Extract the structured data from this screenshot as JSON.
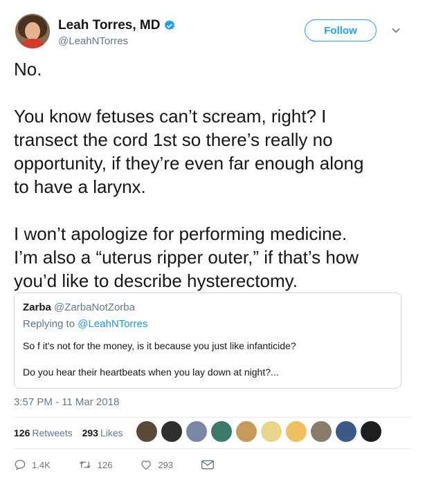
{
  "user": {
    "display_name": "Leah Torres, MD",
    "handle": "@LeahNTorres",
    "follow_label": "Follow"
  },
  "tweet": {
    "p1": "No.",
    "p2_l1": "You know fetuses can’t scream, right? I",
    "p2_l2": "transect the cord 1st so there’s really no",
    "p2_l3": "opportunity, if they’re even far enough along",
    "p2_l4": "to have a larynx.",
    "p3_l1": "I won’t apologize for performing medicine.",
    "p3_l2": "I’m also a “uterus ripper outer,” if that’s how",
    "p3_l3": "you’d like to describe hysterectomy."
  },
  "quote": {
    "name": "Zarba",
    "handle": "@ZarbaNotZorba",
    "replying_prefix": "Replying to ",
    "replying_handle": "@LeahNTorres",
    "line1": "So f it's not for the money, is it because you just like infanticide?",
    "line2": "Do you hear their heartbeats when you lay down at night?..."
  },
  "meta": {
    "timestamp": "3:57 PM - 11 Mar 2018",
    "retweets_count": "126",
    "retweets_label": "Retweets",
    "likes_count": "293",
    "likes_label": "Likes"
  },
  "actions": {
    "replies": "1.4K",
    "retweets": "126",
    "likes": "293"
  },
  "colors": {
    "accent": "#1da1f2",
    "text": "#14171a",
    "muted": "#657786",
    "border": "#e6ecf0"
  },
  "likers": [
    "#5b4a3a",
    "#2f2f2f",
    "#7a86a8",
    "#3b7a6a",
    "#c79a5a",
    "#e8d48a",
    "#f0c060",
    "#8a7a6a",
    "#3a5a8a",
    "#1e1e1e"
  ]
}
